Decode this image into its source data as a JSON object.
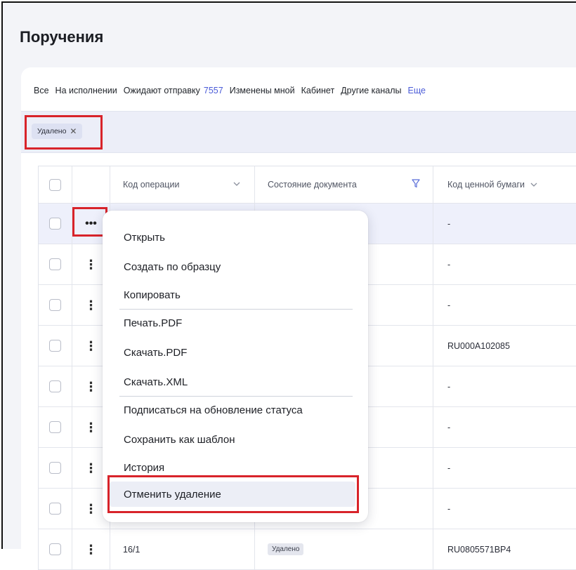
{
  "page": {
    "title": "Поручения"
  },
  "tabs": {
    "all": "Все",
    "in_progress": "На исполнении",
    "awaiting": "Ожидают отправку",
    "awaiting_count": "7557",
    "changed_by_me": "Изменены мной",
    "cabinet": "Кабинет",
    "other_channels": "Другие каналы",
    "more": "Еще"
  },
  "filter": {
    "chip_label": "Удалено",
    "chip_close": "✕"
  },
  "table": {
    "columns": {
      "operation_code": "Код операции",
      "doc_state": "Состояние документа",
      "security_code": "Код ценной бумаги"
    },
    "rows": [
      {
        "security": "-"
      },
      {
        "security": "-"
      },
      {
        "security": "-"
      },
      {
        "security": "RU000A102085"
      },
      {
        "security": "-"
      },
      {
        "security": "-"
      },
      {
        "security": "-"
      },
      {
        "security": "-"
      },
      {
        "code": "16/1",
        "state": "Удалено",
        "security": "RU0805571BP4"
      }
    ]
  },
  "context_menu": {
    "items": [
      "Открыть",
      "Создать по образцу",
      "Копировать",
      "Печать.PDF",
      "Скачать.PDF",
      "Скачать.XML",
      "Подписаться на обновление статуса",
      "Сохранить как шаблон",
      "История",
      "Отменить удаление"
    ]
  },
  "icons": {
    "row_menu_open": "horizontal-ellipsis",
    "row_menu": "vertical-ellipsis",
    "sort": "chevron-down",
    "filter": "funnel",
    "close": "x-mark"
  },
  "colors": {
    "accent": "#4a5bd8",
    "highlight": "#d8232a",
    "badge_bg": "#e4e6ee"
  }
}
